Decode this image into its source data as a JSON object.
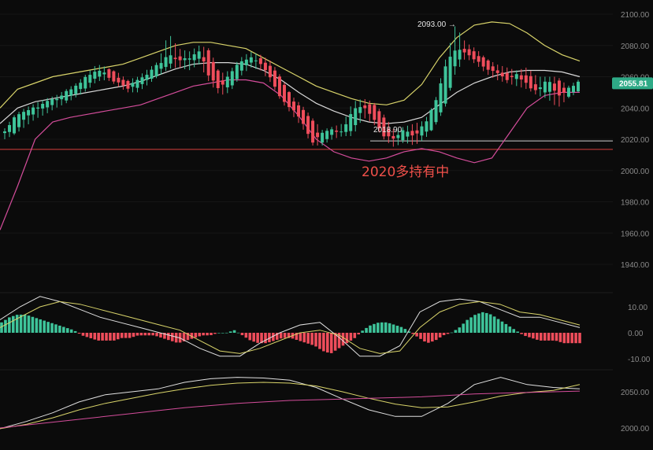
{
  "chart_data": [
    {
      "type": "candlestick",
      "panel": "price",
      "ylim": [
        1930,
        2108
      ],
      "y_ticks": [
        "2100.00",
        "2080.00",
        "2060.00",
        "2040.00",
        "2020.00",
        "2000.00",
        "1980.00",
        "1960.00",
        "1940.00"
      ],
      "y_tick_values": [
        2100,
        2080,
        2060,
        2040,
        2020,
        2000,
        1980,
        1960,
        1940
      ],
      "last_price_label": "2055.81",
      "last_price": 2055.81,
      "high_annotation": "2093.00",
      "high_value": 2093.0,
      "low_annotation": "2018.90",
      "low_value": 2018.9,
      "support_line_value": 2013.5,
      "support_line_label_value": 2018.9,
      "text_annotation": "2020多持有中",
      "ohlc_anchors": [
        [
          2024,
          2027,
          2020,
          2025
        ],
        [
          2025,
          2036,
          2023,
          2034
        ],
        [
          2034,
          2040,
          2028,
          2038
        ],
        [
          2038,
          2043,
          2033,
          2040
        ],
        [
          2040,
          2046,
          2036,
          2044
        ],
        [
          2044,
          2048,
          2040,
          2046
        ],
        [
          2046,
          2052,
          2043,
          2050
        ],
        [
          2050,
          2056,
          2047,
          2054
        ],
        [
          2054,
          2062,
          2051,
          2060
        ],
        [
          2060,
          2068,
          2057,
          2064
        ],
        [
          2064,
          2066,
          2058,
          2061
        ],
        [
          2061,
          2063,
          2054,
          2056
        ],
        [
          2056,
          2058,
          2050,
          2053
        ],
        [
          2053,
          2060,
          2050,
          2058
        ],
        [
          2058,
          2065,
          2055,
          2062
        ],
        [
          2062,
          2070,
          2060,
          2068
        ],
        [
          2068,
          2088,
          2065,
          2074
        ],
        [
          2074,
          2078,
          2066,
          2070
        ],
        [
          2070,
          2076,
          2064,
          2072
        ],
        [
          2072,
          2080,
          2068,
          2076
        ],
        [
          2076,
          2078,
          2056,
          2060
        ],
        [
          2060,
          2062,
          2048,
          2052
        ],
        [
          2052,
          2064,
          2050,
          2062
        ],
        [
          2062,
          2072,
          2060,
          2070
        ],
        [
          2070,
          2076,
          2066,
          2072
        ],
        [
          2072,
          2074,
          2064,
          2068
        ],
        [
          2068,
          2070,
          2056,
          2058
        ],
        [
          2058,
          2060,
          2044,
          2046
        ],
        [
          2046,
          2048,
          2036,
          2040
        ],
        [
          2040,
          2042,
          2028,
          2032
        ],
        [
          2032,
          2034,
          2016,
          2018
        ],
        [
          2018,
          2026,
          2016,
          2024
        ],
        [
          2024,
          2028,
          2020,
          2026
        ],
        [
          2026,
          2030,
          2022,
          2024
        ],
        [
          2024,
          2044,
          2022,
          2040
        ],
        [
          2040,
          2046,
          2034,
          2042
        ],
        [
          2042,
          2044,
          2030,
          2034
        ],
        [
          2034,
          2036,
          2020,
          2022
        ],
        [
          2022,
          2026,
          2015,
          2020
        ],
        [
          2020,
          2028,
          2018,
          2026
        ],
        [
          2026,
          2030,
          2016,
          2022
        ],
        [
          2022,
          2032,
          2020,
          2030
        ],
        [
          2030,
          2044,
          2028,
          2042
        ],
        [
          2042,
          2070,
          2040,
          2066
        ],
        [
          2066,
          2093,
          2062,
          2078
        ],
        [
          2078,
          2082,
          2072,
          2076
        ],
        [
          2076,
          2078,
          2068,
          2070
        ],
        [
          2070,
          2072,
          2062,
          2066
        ],
        [
          2066,
          2068,
          2058,
          2062
        ],
        [
          2062,
          2066,
          2056,
          2058
        ],
        [
          2058,
          2064,
          2054,
          2062
        ],
        [
          2062,
          2066,
          2052,
          2055
        ],
        [
          2055,
          2060,
          2048,
          2050
        ],
        [
          2050,
          2060,
          2046,
          2058
        ],
        [
          2058,
          2060,
          2040,
          2048
        ],
        [
          2048,
          2054,
          2046,
          2052
        ],
        [
          2052,
          2058,
          2050,
          2056
        ]
      ],
      "series": [
        {
          "name": "",
          "color": "#d9d46a",
          "values": [
            2040,
            2052,
            2056,
            2060,
            2062,
            2064,
            2066,
            2068,
            2072,
            2076,
            2080,
            2082,
            2082,
            2080,
            2078,
            2072,
            2066,
            2060,
            2054,
            2050,
            2046,
            2043,
            2042,
            2045,
            2055,
            2072,
            2085,
            2093,
            2095,
            2094,
            2088,
            2080,
            2074,
            2070
          ]
        },
        {
          "name": "",
          "color": "#d9d9d9",
          "values": [
            2030,
            2040,
            2044,
            2046,
            2048,
            2050,
            2052,
            2054,
            2057,
            2061,
            2065,
            2068,
            2069,
            2069,
            2068,
            2064,
            2058,
            2050,
            2043,
            2038,
            2034,
            2031,
            2030,
            2031,
            2034,
            2042,
            2050,
            2056,
            2060,
            2063,
            2064,
            2064,
            2063,
            2060
          ]
        },
        {
          "name": "",
          "color": "#d44d9b",
          "values": [
            1962,
            1990,
            2020,
            2031,
            2034,
            2036,
            2038,
            2040,
            2042,
            2046,
            2050,
            2054,
            2056,
            2058,
            2058,
            2056,
            2048,
            2035,
            2020,
            2012,
            2008,
            2006,
            2008,
            2012,
            2014,
            2012,
            2008,
            2005,
            2008,
            2024,
            2040,
            2048,
            2050,
            2050
          ]
        }
      ]
    },
    {
      "type": "bar",
      "panel": "macd",
      "ylim": [
        -14,
        14
      ],
      "y_ticks": [
        "10.00",
        "0.00",
        "-10.00"
      ],
      "y_tick_values": [
        10,
        0,
        -10
      ],
      "histogram": [
        4,
        6,
        7,
        7,
        6,
        5,
        4,
        3,
        2,
        1,
        -1,
        -2,
        -3,
        -3,
        -3,
        -2,
        -2,
        -1,
        -1,
        -1,
        -2,
        -3,
        -4,
        -3,
        -2,
        -1,
        -1,
        0,
        0,
        1,
        -1,
        -3,
        -4,
        -4,
        -3,
        -2,
        -2,
        -3,
        -4,
        -5,
        -7,
        -8,
        -6,
        -4,
        -2,
        1,
        3,
        4,
        4,
        3,
        2,
        0,
        -2,
        -4,
        -3,
        -1,
        0,
        2,
        5,
        7,
        8,
        7,
        5,
        3,
        1,
        -1,
        -2,
        -3,
        -3,
        -3,
        -4,
        -4,
        -4
      ],
      "series": [
        {
          "name": "",
          "color": "#e0e0e0",
          "values": [
            5,
            10,
            14,
            12,
            9,
            6,
            4,
            2,
            0,
            -2,
            -6,
            -9,
            -9,
            -4,
            0,
            3,
            4,
            -2,
            -9,
            -9,
            -5,
            8,
            12,
            13,
            12,
            9,
            6,
            6,
            4,
            2
          ]
        },
        {
          "name": "",
          "color": "#d9d46a",
          "values": [
            2,
            6,
            10,
            12,
            11,
            9,
            7,
            5,
            3,
            1,
            -3,
            -7,
            -8,
            -6,
            -3,
            0,
            1,
            -1,
            -6,
            -8,
            -7,
            2,
            8,
            11,
            12,
            11,
            8,
            7,
            5,
            3
          ]
        }
      ]
    },
    {
      "type": "line",
      "panel": "lower",
      "ylim": [
        1990,
        2080
      ],
      "y_ticks": [
        "2050.00",
        "2000.00"
      ],
      "y_tick_values": [
        2050,
        2000
      ],
      "series": [
        {
          "name": "",
          "color": "#e0e0e0",
          "values": [
            1999,
            2009,
            2021,
            2036,
            2046,
            2050,
            2054,
            2063,
            2068,
            2070,
            2069,
            2066,
            2056,
            2040,
            2025,
            2016,
            2016,
            2034,
            2060,
            2070,
            2060,
            2056,
            2054
          ]
        },
        {
          "name": "",
          "color": "#d9d46a",
          "values": [
            1999,
            2005,
            2014,
            2025,
            2034,
            2041,
            2048,
            2054,
            2059,
            2062,
            2063,
            2062,
            2058,
            2050,
            2041,
            2033,
            2028,
            2029,
            2036,
            2044,
            2049,
            2052,
            2060
          ]
        },
        {
          "name": "",
          "color": "#d44d9b",
          "values": [
            2000,
            2004,
            2008,
            2012,
            2016,
            2020,
            2024,
            2028,
            2031,
            2034,
            2036,
            2038,
            2039,
            2040,
            2041,
            2042,
            2043,
            2045,
            2047,
            2048,
            2049,
            2050,
            2051
          ]
        }
      ]
    }
  ]
}
